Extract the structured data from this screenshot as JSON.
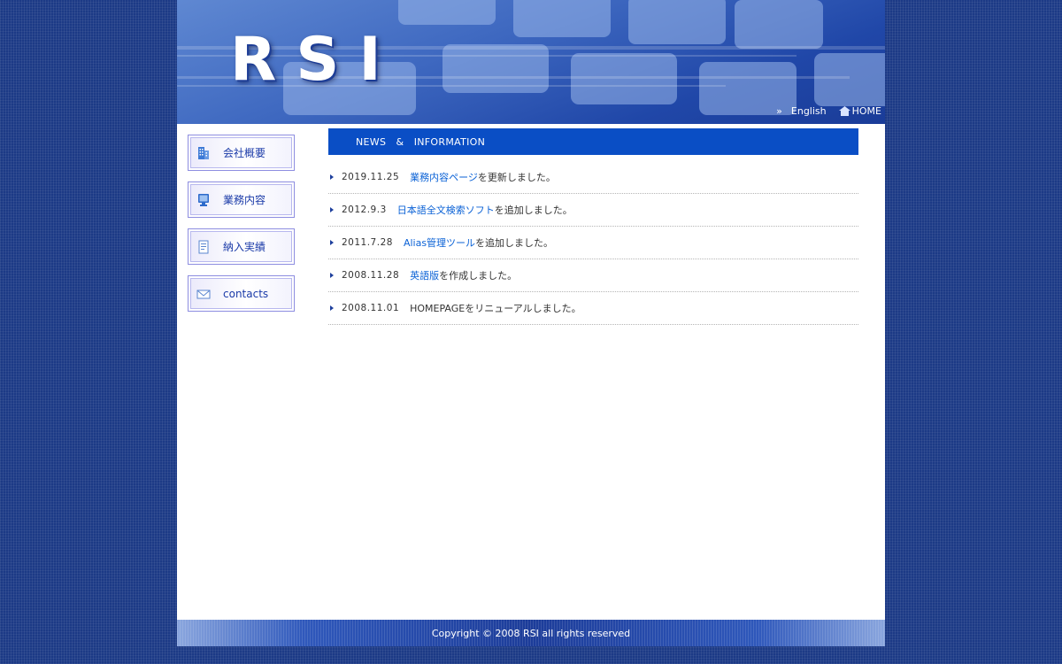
{
  "header": {
    "logo_text": "RSI",
    "links": [
      {
        "label": "English"
      },
      {
        "label": "HOME"
      }
    ]
  },
  "sidebar": {
    "items": [
      {
        "label": "会社概要",
        "icon": "building-icon"
      },
      {
        "label": "業務内容",
        "icon": "monitor-icon"
      },
      {
        "label": "納入実績",
        "icon": "document-icon"
      },
      {
        "label": "contacts",
        "icon": "envelope-icon"
      }
    ]
  },
  "news": {
    "title": "NEWS　&　INFORMATION",
    "items": [
      {
        "date": "2019.11.25",
        "link": "業務内容ページ",
        "rest": "を更新しました。"
      },
      {
        "date": "2012.9.3",
        "link": "日本語全文検索ソフト",
        "rest": "を追加しました。"
      },
      {
        "date": "2011.7.28",
        "link": "Alias管理ツール",
        "rest": "を追加しました。"
      },
      {
        "date": "2008.11.28",
        "link": "英語版",
        "rest": "を作成しました。"
      },
      {
        "date": "2008.11.01",
        "link": "",
        "rest": "HOMEPAGEをリニューアルしました。"
      }
    ]
  },
  "footer": {
    "copyright": "Copyright © 2008 RSI all rights reserved"
  },
  "colors": {
    "page_bg": "#1c3a86",
    "news_header": "#0a4ec5",
    "link": "#0b62d6"
  }
}
